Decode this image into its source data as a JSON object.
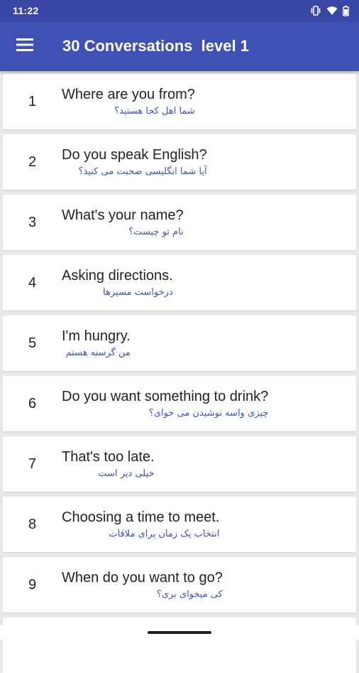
{
  "status_bar": {
    "time": "11:22"
  },
  "app_bar": {
    "title": "30 Conversations  level 1",
    "menu_icon": "hamburger-menu-icon"
  },
  "conversations": [
    {
      "number": "1",
      "title": "Where are you from?",
      "subtitle": "شما اهل کجا هستید؟"
    },
    {
      "number": "2",
      "title": "Do you speak English?",
      "subtitle": "آیا شما انگلیسی صحبت می کنید؟"
    },
    {
      "number": "3",
      "title": "What's your name?",
      "subtitle": "نام تو چیست؟"
    },
    {
      "number": "4",
      "title": "Asking directions.",
      "subtitle": "درخواست مسیرها"
    },
    {
      "number": "5",
      "title": "I'm hungry.",
      "subtitle": "من گرسنه هستم"
    },
    {
      "number": "6",
      "title": "Do you want something to drink?",
      "subtitle": "چیزی واسه نوشیدن می خوای؟"
    },
    {
      "number": "7",
      "title": "That's too late.",
      "subtitle": "خیلی دیر است"
    },
    {
      "number": "8",
      "title": "Choosing a time to meet.",
      "subtitle": "انتخاب یک زمان برای ملاقات"
    },
    {
      "number": "9",
      "title": "When do you want to go?",
      "subtitle": "کی میخوای بری؟"
    }
  ],
  "colors": {
    "status_bar": "#3a47a6",
    "app_bar": "#3f51b5",
    "subtitle_text": "#3f51b5",
    "background": "#e8e8e8"
  }
}
